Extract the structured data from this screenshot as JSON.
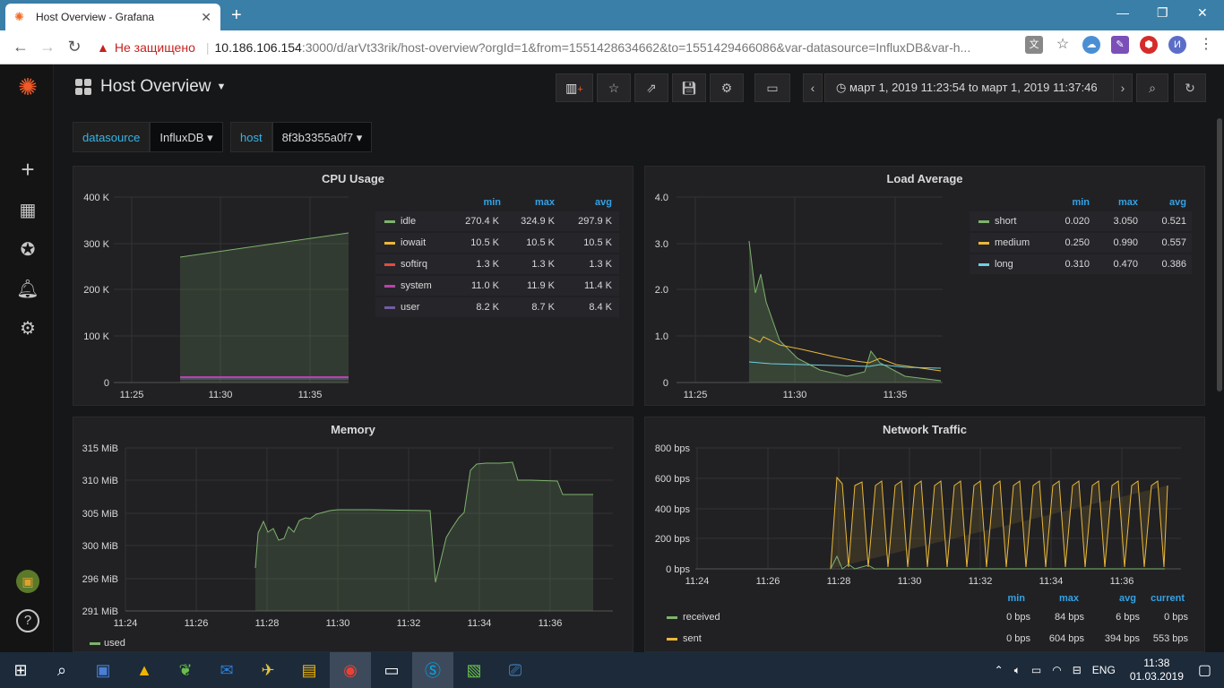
{
  "browser": {
    "tab_title": "Host Overview - Grafana",
    "insecure_label": "Не защищено",
    "url_host": "10.186.106.154",
    "url_rest": ":3000/d/arVt33rik/host-overview?orgId=1&from=1551428634662&to=1551429466086&var-datasource=InfluxDB&var-h...",
    "profile_initial": "И"
  },
  "dashboard": {
    "title": "Host Overview",
    "time_range": "март 1, 2019 11:23:54 to март 1, 2019 11:37:46",
    "variables": [
      {
        "label": "datasource",
        "value": "InfluxDB"
      },
      {
        "label": "host",
        "value": "8f3b3355a0f7"
      }
    ]
  },
  "panels": {
    "cpu": {
      "title": "CPU Usage",
      "legend_headers": [
        "min",
        "max",
        "avg"
      ],
      "legend": [
        {
          "name": "idle",
          "min": "270.4 K",
          "max": "324.9 K",
          "avg": "297.9 K",
          "color": "#7eb26d"
        },
        {
          "name": "iowait",
          "min": "10.5 K",
          "max": "10.5 K",
          "avg": "10.5 K",
          "color": "#eab839"
        },
        {
          "name": "softirq",
          "min": "1.3 K",
          "max": "1.3 K",
          "avg": "1.3 K",
          "color": "#e24d42"
        },
        {
          "name": "system",
          "min": "11.0 K",
          "max": "11.9 K",
          "avg": "11.4 K",
          "color": "#ba43a9"
        },
        {
          "name": "user",
          "min": "8.2 K",
          "max": "8.7 K",
          "avg": "8.4 K",
          "color": "#705da0"
        }
      ],
      "y_ticks": [
        "400 K",
        "300 K",
        "200 K",
        "100 K",
        "0"
      ],
      "x_ticks": [
        "11:25",
        "11:30",
        "11:35"
      ]
    },
    "load": {
      "title": "Load Average",
      "legend_headers": [
        "min",
        "max",
        "avg"
      ],
      "legend": [
        {
          "name": "short",
          "min": "0.020",
          "max": "3.050",
          "avg": "0.521",
          "color": "#7eb26d"
        },
        {
          "name": "medium",
          "min": "0.250",
          "max": "0.990",
          "avg": "0.557",
          "color": "#eab839"
        },
        {
          "name": "long",
          "min": "0.310",
          "max": "0.470",
          "avg": "0.386",
          "color": "#6ed0e0"
        }
      ],
      "y_ticks": [
        "4.0",
        "3.0",
        "2.0",
        "1.0",
        "0"
      ],
      "x_ticks": [
        "11:25",
        "11:30",
        "11:35"
      ]
    },
    "memory": {
      "title": "Memory",
      "legend": [
        {
          "name": "used",
          "color": "#7eb26d"
        }
      ],
      "y_ticks": [
        "315 MiB",
        "310 MiB",
        "305 MiB",
        "300 MiB",
        "296 MiB",
        "291 MiB"
      ],
      "x_ticks": [
        "11:24",
        "11:26",
        "11:28",
        "11:30",
        "11:32",
        "11:34",
        "11:36"
      ]
    },
    "network": {
      "title": "Network Traffic",
      "legend_headers": [
        "min",
        "max",
        "avg",
        "current"
      ],
      "legend": [
        {
          "name": "received",
          "min": "0 bps",
          "max": "84 bps",
          "avg": "6 bps",
          "current": "0 bps",
          "color": "#7eb26d"
        },
        {
          "name": "sent",
          "min": "0 bps",
          "max": "604 bps",
          "avg": "394 bps",
          "current": "553 bps",
          "color": "#eab839"
        }
      ],
      "y_ticks": [
        "800 bps",
        "600 bps",
        "400 bps",
        "200 bps",
        "0 bps"
      ],
      "x_ticks": [
        "11:24",
        "11:26",
        "11:28",
        "11:30",
        "11:32",
        "11:34",
        "11:36"
      ]
    }
  },
  "chart_data": [
    {
      "type": "area",
      "title": "CPU Usage",
      "x": [
        "11:27:30",
        "11:37:00"
      ],
      "ylim": [
        0,
        400000
      ],
      "series": [
        {
          "name": "idle",
          "values": [
            270400,
            324900
          ]
        },
        {
          "name": "iowait",
          "values": [
            10500,
            10500
          ]
        },
        {
          "name": "softirq",
          "values": [
            1300,
            1300
          ]
        },
        {
          "name": "system",
          "values": [
            11000,
            11900
          ]
        },
        {
          "name": "user",
          "values": [
            8200,
            8700
          ]
        }
      ]
    },
    {
      "type": "line",
      "title": "Load Average",
      "ylim": [
        0,
        4
      ],
      "series": [
        {
          "name": "short",
          "values": [
            3.05,
            1.6,
            2.0,
            1.4,
            0.9,
            0.5,
            0.3,
            0.2,
            0.1,
            0.1,
            0.65,
            0.2,
            0.05,
            0.02
          ]
        },
        {
          "name": "medium",
          "values": [
            0.99,
            0.9,
            0.95,
            0.8,
            0.7,
            0.65,
            0.6,
            0.55,
            0.45,
            0.4,
            0.5,
            0.4,
            0.3,
            0.25
          ]
        },
        {
          "name": "long",
          "values": [
            0.45,
            0.43,
            0.47,
            0.44,
            0.43,
            0.42,
            0.41,
            0.4,
            0.38,
            0.36,
            0.4,
            0.36,
            0.33,
            0.31
          ]
        }
      ]
    },
    {
      "type": "area",
      "title": "Memory",
      "ylim": [
        291,
        315
      ],
      "series": [
        {
          "name": "used",
          "values": [
            296,
            302,
            304,
            303,
            301,
            303,
            302,
            304,
            305,
            305,
            305.5,
            305.5,
            305.5,
            305.5,
            305,
            295,
            301,
            307,
            312,
            312.5,
            312.5,
            310,
            310,
            308,
            308
          ]
        }
      ]
    },
    {
      "type": "line",
      "title": "Network Traffic",
      "ylim": [
        0,
        800
      ],
      "series": [
        {
          "name": "received",
          "values": [
            84,
            0,
            0,
            0,
            0
          ]
        },
        {
          "name": "sent",
          "values": [
            0,
            604,
            0,
            553,
            0,
            553,
            0,
            553,
            0,
            553
          ]
        }
      ]
    }
  ],
  "taskbar": {
    "lang": "ENG",
    "time": "11:38",
    "date": "01.03.2019"
  }
}
